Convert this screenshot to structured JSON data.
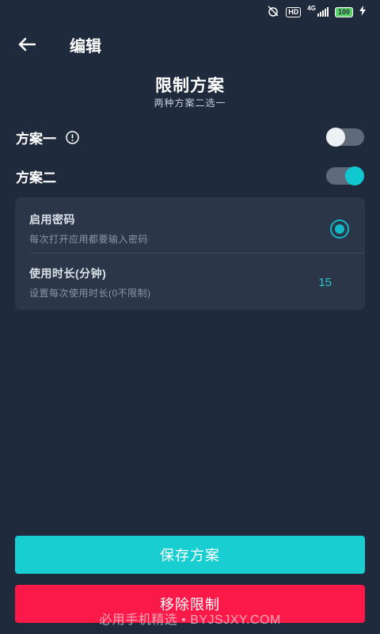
{
  "status_bar": {
    "network": "4G",
    "hd": "HD",
    "battery": "100"
  },
  "header": {
    "title": "编辑",
    "back_icon": "arrow-left-icon"
  },
  "plan": {
    "title": "限制方案",
    "subtitle": "两种方案二选一"
  },
  "options": [
    {
      "label": "方案一",
      "enabled": false,
      "has_info_icon": true
    },
    {
      "label": "方案二",
      "enabled": true
    }
  ],
  "settings": {
    "password": {
      "title": "启用密码",
      "description": "每次打开应用都要输入密码",
      "selected": true
    },
    "duration": {
      "title": "使用时长(分钟)",
      "description": "设置每次使用时长(0不限制)",
      "value": "15"
    }
  },
  "buttons": {
    "save_label": "保存方案",
    "remove_label": "移除限制"
  },
  "watermark": "必用手机精选 • BYJSJXY.COM",
  "colors": {
    "background": "#1f2a3c",
    "card": "#2b3648",
    "accent": "#18ced1",
    "danger": "#fa1948"
  }
}
